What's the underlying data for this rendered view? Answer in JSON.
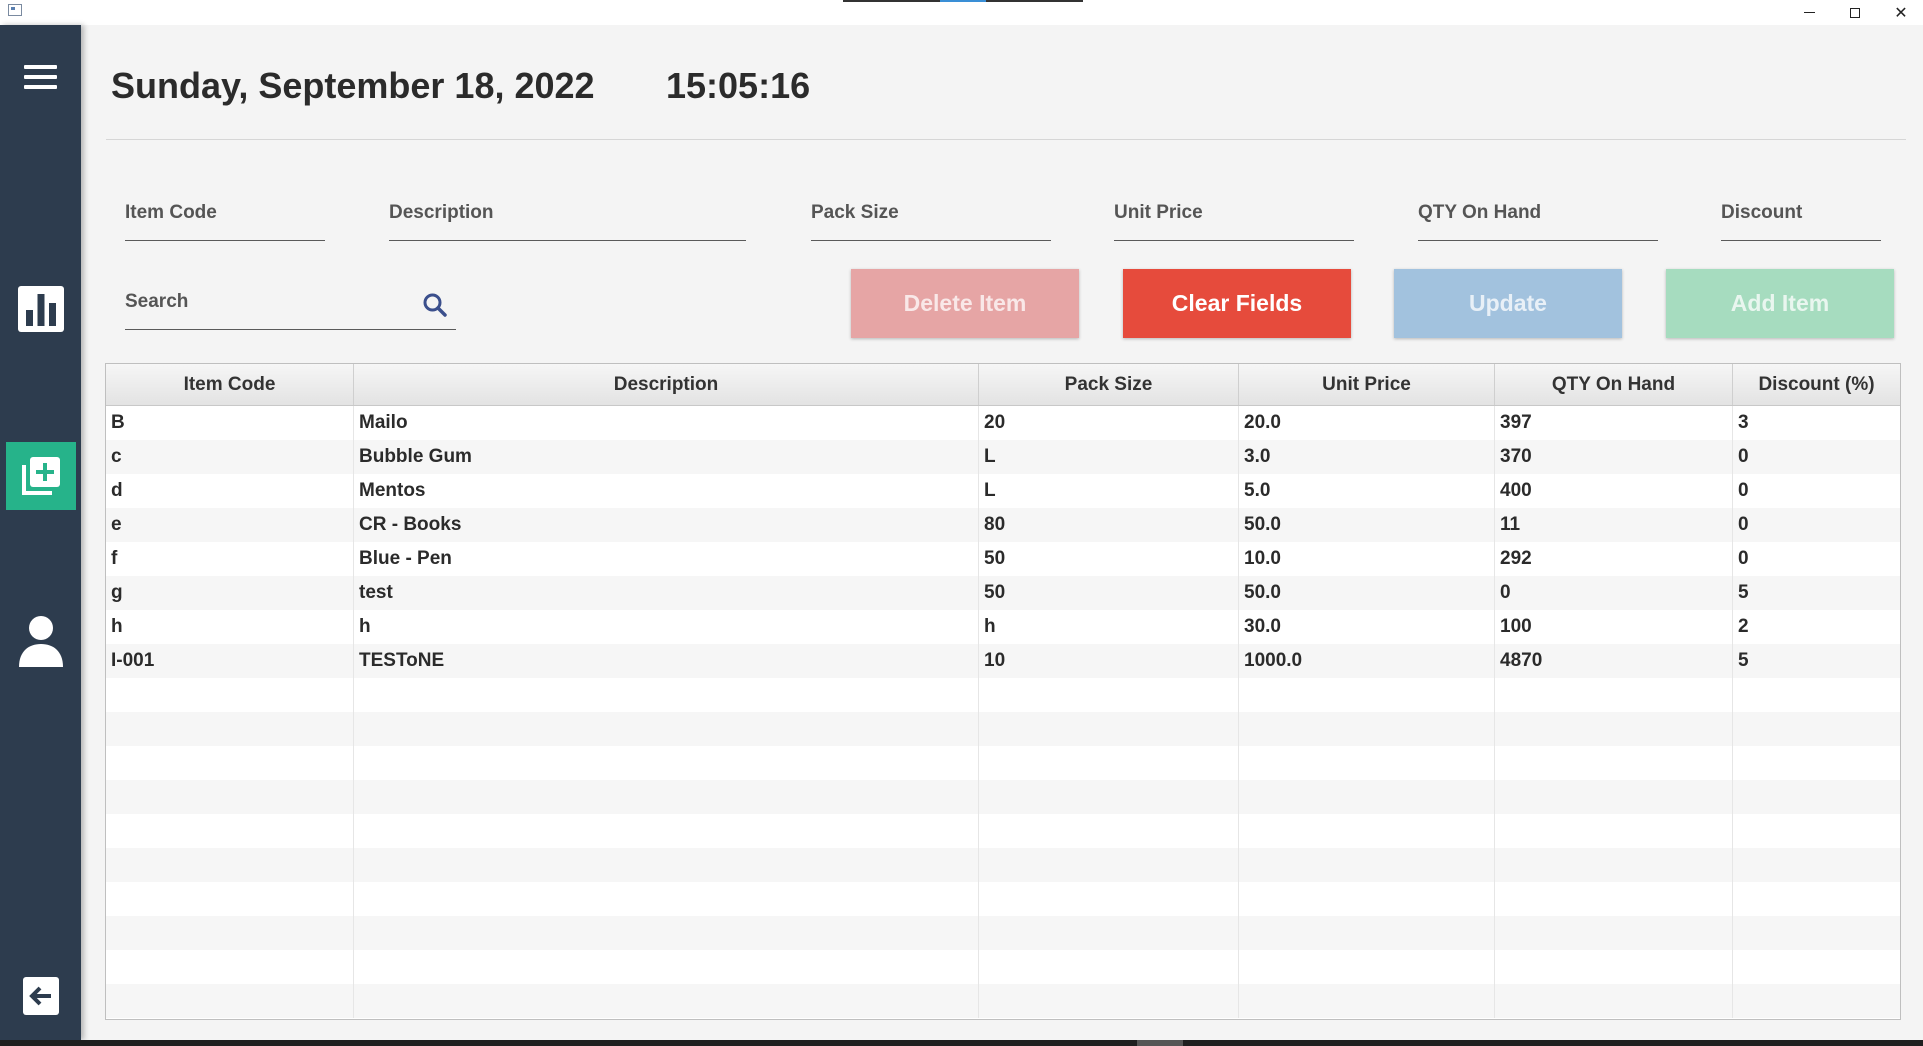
{
  "window": {
    "controls": {
      "minimize": "minimize",
      "maximize": "maximize",
      "close": "close"
    }
  },
  "sidebar": {
    "items": [
      {
        "name": "menu",
        "icon": "hamburger-menu-icon"
      },
      {
        "name": "dashboard",
        "icon": "bar-chart-icon"
      },
      {
        "name": "inventory",
        "icon": "add-stack-icon",
        "active": true
      },
      {
        "name": "user",
        "icon": "user-icon"
      },
      {
        "name": "logout",
        "icon": "back-arrow-icon"
      }
    ],
    "active_color": "#26b38a",
    "background": "#2d3c4e"
  },
  "header": {
    "date": "Sunday, September 18, 2022",
    "time": "15:05:16"
  },
  "form": {
    "item_code": {
      "placeholder": "Item Code",
      "value": ""
    },
    "description": {
      "placeholder": "Description",
      "value": ""
    },
    "pack_size": {
      "placeholder": "Pack Size",
      "value": ""
    },
    "unit_price": {
      "placeholder": "Unit Price",
      "value": ""
    },
    "qty_on_hand": {
      "placeholder": "QTY On Hand",
      "value": ""
    },
    "discount": {
      "placeholder": "Discount",
      "value": ""
    },
    "search": {
      "placeholder": "Search",
      "value": ""
    }
  },
  "buttons": {
    "delete": {
      "label": "Delete Item",
      "enabled": false,
      "color": "#e64b3c"
    },
    "clear": {
      "label": "Clear Fields",
      "enabled": true,
      "color": "#e64b3c"
    },
    "update": {
      "label": "Update",
      "enabled": false,
      "color": "#5b9bd5"
    },
    "add": {
      "label": "Add Item",
      "enabled": false,
      "color": "#4cbf80"
    }
  },
  "table": {
    "columns": [
      "Item Code",
      "Description",
      "Pack Size",
      "Unit Price",
      "QTY On Hand",
      "Discount (%)"
    ],
    "rows": [
      [
        "B",
        "Mailo",
        "20",
        "20.0",
        "397",
        "3"
      ],
      [
        "c",
        "Bubble Gum",
        "L",
        "3.0",
        "370",
        "0"
      ],
      [
        "d",
        "Mentos",
        "L",
        "5.0",
        "400",
        "0"
      ],
      [
        "e",
        "CR - Books",
        "80",
        "50.0",
        "11",
        "0"
      ],
      [
        "f",
        "Blue - Pen",
        "50",
        "10.0",
        "292",
        "0"
      ],
      [
        "g",
        "test",
        "50",
        "50.0",
        "0",
        "5"
      ],
      [
        "h",
        "h",
        "h",
        "30.0",
        "100",
        "2"
      ],
      [
        "I-001",
        "TESToNE",
        "10",
        "1000.0",
        "4870",
        "5"
      ]
    ]
  }
}
